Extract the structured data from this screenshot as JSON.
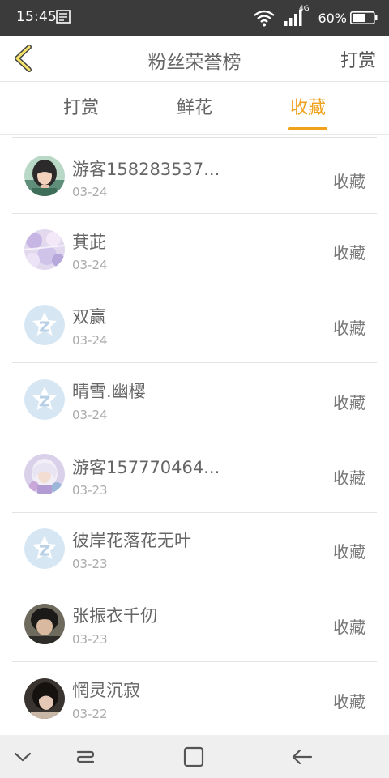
{
  "status_bar": {
    "time": "15:45",
    "network": "4G",
    "battery": "60%",
    "battery_level": 0.6
  },
  "header": {
    "title": "粉丝荣誉榜",
    "right_action": "打赏"
  },
  "tabs": [
    {
      "label": "打赏"
    },
    {
      "label": "鲜花"
    },
    {
      "label": "收藏"
    }
  ],
  "active_tab": "收藏",
  "colors": {
    "accent": "#f0a21c",
    "status_bar": "#3b3b3b",
    "nav_bar": "#efefef",
    "text": "#666666",
    "date_text": "#aaaaaa",
    "default_avatar": "#d6e6f3"
  },
  "list": [
    {
      "name": "游客158283537...",
      "date": "03-24",
      "action": "收藏",
      "avatar": "anime-portrait-avatar"
    },
    {
      "name": "萁茈",
      "date": "03-24",
      "action": "收藏",
      "avatar": "pastel-pattern-avatar"
    },
    {
      "name": "双赢",
      "date": "03-24",
      "action": "收藏",
      "avatar": "default-z-avatar"
    },
    {
      "name": "晴雪.幽樱",
      "date": "03-24",
      "action": "收藏",
      "avatar": "default-z-avatar"
    },
    {
      "name": "游客157770464...",
      "date": "03-23",
      "action": "收藏",
      "avatar": "anime-girl-avatar"
    },
    {
      "name": "彼岸花落花无叶",
      "date": "03-23",
      "action": "收藏",
      "avatar": "default-z-avatar"
    },
    {
      "name": "张振衣千仞",
      "date": "03-23",
      "action": "收藏",
      "avatar": "dark-hair-avatar"
    },
    {
      "name": "惘灵沉寂",
      "date": "03-22",
      "action": "收藏",
      "avatar": "dark-hair-avatar"
    }
  ],
  "nav_bar": {
    "icons": [
      "chevron-down-icon",
      "recent-apps-icon",
      "home-square-icon",
      "back-arrow-icon"
    ]
  }
}
